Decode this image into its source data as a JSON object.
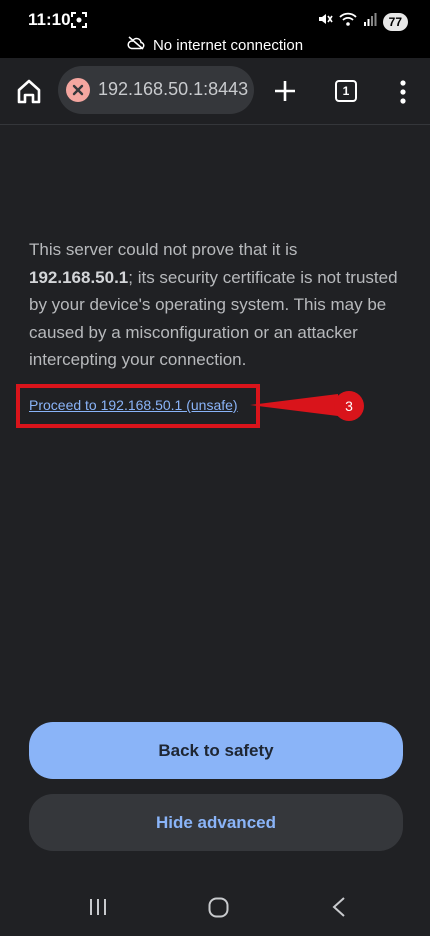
{
  "status_bar": {
    "time": "11:10",
    "battery": "77"
  },
  "offline_banner": {
    "text": "No internet connection"
  },
  "toolbar": {
    "url": "192.168.50.1:8443",
    "tab_count": "1"
  },
  "page": {
    "message_part1": "This server could not prove that it is ",
    "message_host": "192.168.50.1",
    "message_part2": "; its security certificate is not trusted by your device's operating system. This may be caused by a misconfiguration or an attacker intercepting your connection.",
    "proceed_link": "Proceed to 192.168.50.1 (unsafe)",
    "callout_number": "3",
    "back_button": "Back to safety",
    "hide_button": "Hide advanced"
  },
  "colors": {
    "page_background": "#202124",
    "link": "#8ab4f8",
    "annotation_red": "#d9141b"
  }
}
